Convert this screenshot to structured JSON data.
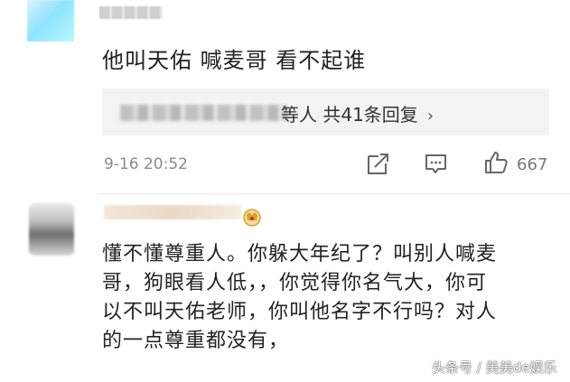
{
  "comment1": {
    "text": "他叫天佑  喊麦哥  看不起谁",
    "reply_summary": "等人  共41条回复",
    "reply_arrow": "›",
    "timestamp": "9-16 20:52",
    "likes": "667",
    "icons": [
      "share-icon",
      "comment-icon",
      "like-icon"
    ]
  },
  "comment2": {
    "lines": [
      "懂不懂尊重人。你躲大年纪了？叫别人喊麦",
      "哥，狗眼看人低，，你觉得你名气大，你可",
      "以不叫天佑老师，你叫他名字不行吗？对人",
      "的一点尊重都没有，"
    ],
    "badge_icon": "vip-badge-icon"
  },
  "watermark": "头条号 / 美美de娱乐",
  "colors": {
    "text": "#222222",
    "meta": "#8a8a8a",
    "reply_bg": "#f3f3f3",
    "badge": "#d8a425"
  }
}
